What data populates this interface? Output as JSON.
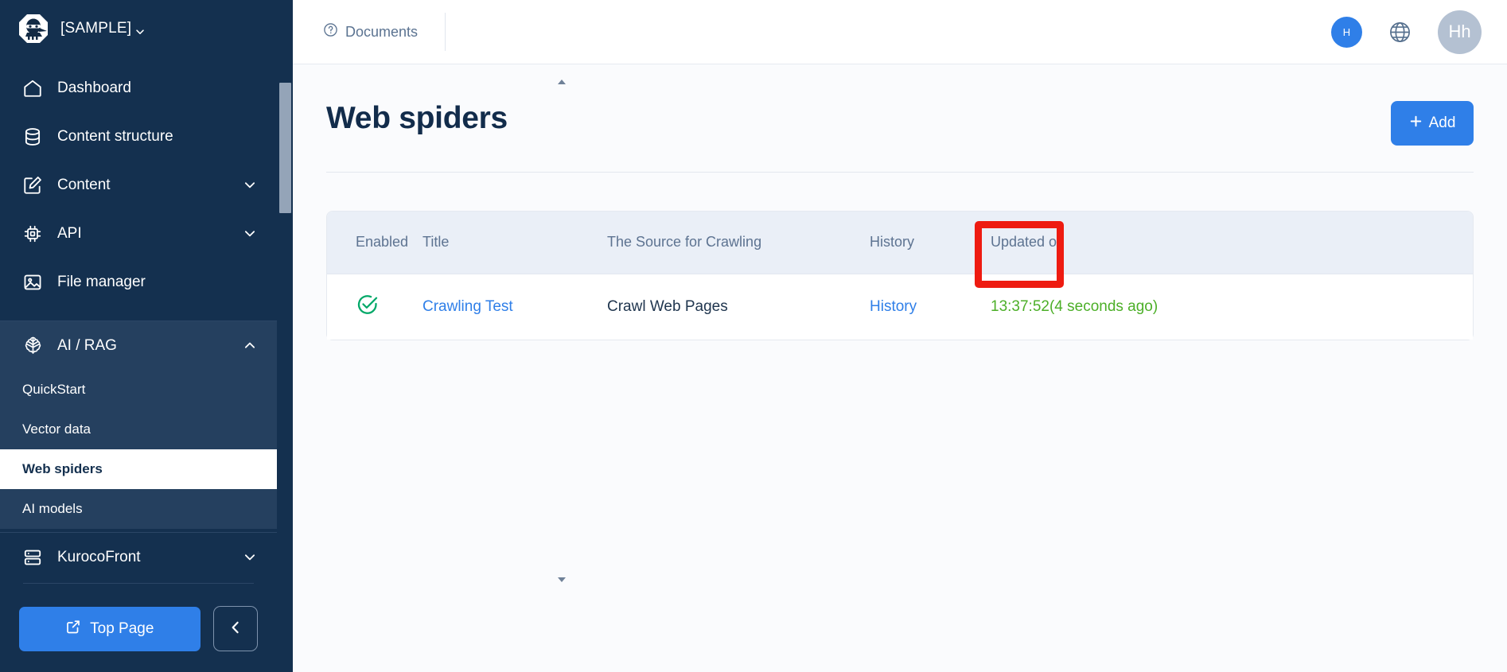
{
  "sidebar": {
    "brand": {
      "logo_icon": "ninja-logo-icon",
      "name": "[SAMPLE]",
      "caret_icon": "chevron-down-icon"
    },
    "main_items": [
      {
        "label": "Dashboard",
        "icon": "home-icon",
        "chevron": ""
      },
      {
        "label": "Content structure",
        "icon": "database-icon",
        "chevron": ""
      },
      {
        "label": "Content",
        "icon": "edit-square-icon",
        "chevron": "chevron-down-icon"
      },
      {
        "label": "API",
        "icon": "chip-icon",
        "chevron": "chevron-down-icon"
      },
      {
        "label": "File manager",
        "icon": "image-icon",
        "chevron": ""
      }
    ],
    "rag_section": {
      "label": "AI / RAG",
      "icon": "brain-icon",
      "chevron": "chevron-up-icon",
      "items": [
        {
          "label": "QuickStart",
          "active": false
        },
        {
          "label": "Vector data",
          "active": false
        },
        {
          "label": "Web spiders",
          "active": true
        },
        {
          "label": "AI models",
          "active": false
        }
      ]
    },
    "bottom_items": [
      {
        "label": "KurocoFront",
        "icon": "server-icon",
        "chevron": "chevron-down-icon"
      }
    ],
    "footer": {
      "top_page_label": "Top Page",
      "top_page_icon": "external-link-icon",
      "collapse_icon": "chevron-left-icon"
    },
    "scrollbar": {
      "up_arrow_icon": "triangle-up-icon",
      "down_arrow_icon": "triangle-down-icon"
    }
  },
  "topbar": {
    "documents_label": "Documents",
    "documents_icon": "question-circle-icon",
    "notification_badge": "H",
    "globe_icon": "globe-icon",
    "avatar_initials": "Hh"
  },
  "page": {
    "title": "Web spiders",
    "add_label": "Add",
    "add_icon": "plus-icon"
  },
  "table": {
    "columns": [
      "Enabled",
      "Title",
      "The Source for Crawling",
      "History",
      "Updated on"
    ],
    "rows": [
      {
        "enabled_icon": "circle-check-icon",
        "title": "Crawling Test",
        "source": "Crawl Web Pages",
        "history": "History",
        "updated_on": "13:37:52(4 seconds ago)"
      }
    ]
  },
  "highlight": {
    "target": "History",
    "color": "#ee1b11"
  },
  "colors": {
    "sidebar_bg": "#14304f",
    "sidebar_section_bg": "#25405f",
    "accent_blue": "#2f7fe8",
    "green": "#4caf28",
    "header_bg": "#eaeff7",
    "highlight_red": "#ee1b11"
  }
}
